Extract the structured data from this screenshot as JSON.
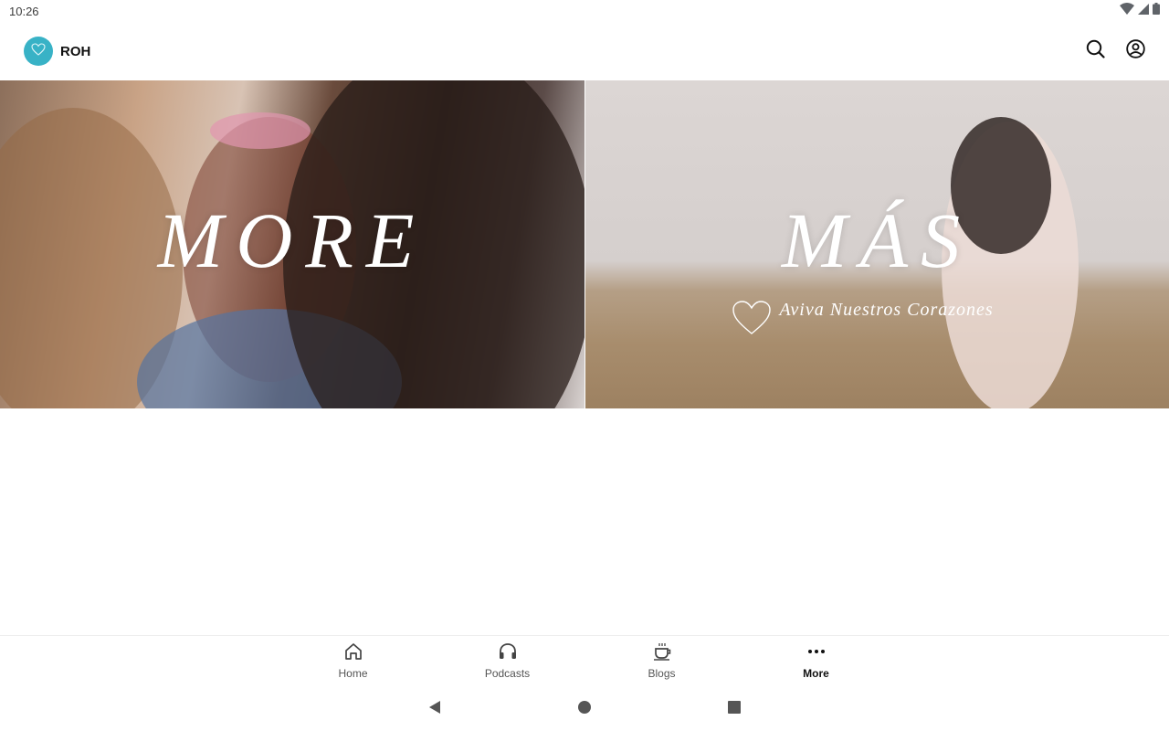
{
  "status_bar": {
    "time": "10:26"
  },
  "app_bar": {
    "brand_name": "ROH",
    "brand_color": "#38b2c6"
  },
  "banners": [
    {
      "title": "MORE"
    },
    {
      "title": "MÁS",
      "subtitle": "Aviva Nuestros Corazones"
    }
  ],
  "bottom_nav": {
    "active": "More",
    "items": [
      {
        "label": "Home",
        "icon": "home-icon"
      },
      {
        "label": "Podcasts",
        "icon": "headphones-icon"
      },
      {
        "label": "Blogs",
        "icon": "coffee-cup-icon"
      },
      {
        "label": "More",
        "icon": "more-dots-icon"
      }
    ]
  }
}
